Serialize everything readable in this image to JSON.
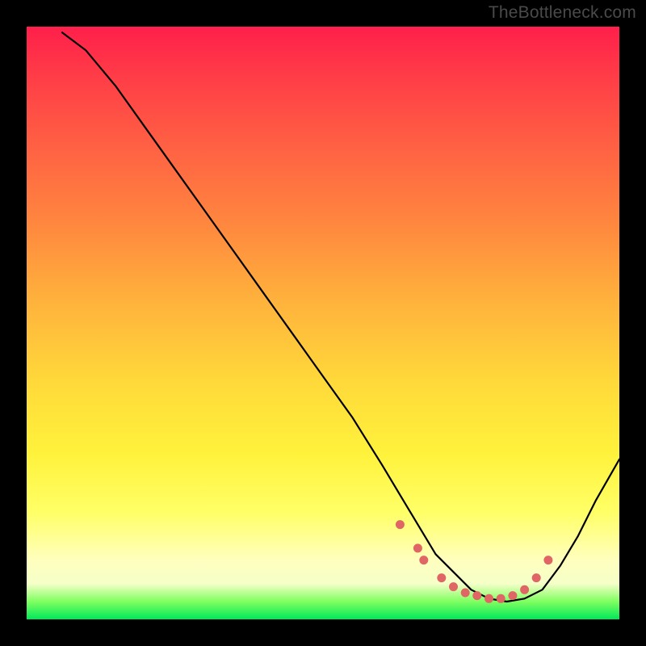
{
  "watermark": "TheBottleneck.com",
  "chart_data": {
    "type": "line",
    "title": "",
    "xlabel": "",
    "ylabel": "",
    "xlim": [
      0,
      100
    ],
    "ylim": [
      0,
      100
    ],
    "grid": false,
    "legend": false,
    "series": [
      {
        "name": "curve",
        "style": "solid",
        "color": "#000000",
        "x": [
          6,
          10,
          15,
          20,
          25,
          30,
          35,
          40,
          45,
          50,
          55,
          60,
          63,
          66,
          69,
          72,
          75,
          78,
          81,
          84,
          87,
          90,
          93,
          96,
          100
        ],
        "y": [
          99,
          96,
          90,
          83,
          76,
          69,
          62,
          55,
          48,
          41,
          34,
          26,
          21,
          16,
          11,
          8,
          5,
          3.5,
          3,
          3.5,
          5,
          9,
          14,
          20,
          27
        ]
      },
      {
        "name": "highlight-dots",
        "style": "dots",
        "color": "#e06666",
        "x": [
          63,
          66,
          67,
          70,
          72,
          74,
          76,
          78,
          80,
          82,
          84,
          86,
          88
        ],
        "y": [
          16,
          12,
          10,
          7,
          5.5,
          4.5,
          4,
          3.5,
          3.5,
          4,
          5,
          7,
          10
        ]
      }
    ],
    "gradient_background": {
      "orientation": "vertical",
      "top_color": "#ff1f4b",
      "bottom_color": "#00e85a"
    }
  }
}
